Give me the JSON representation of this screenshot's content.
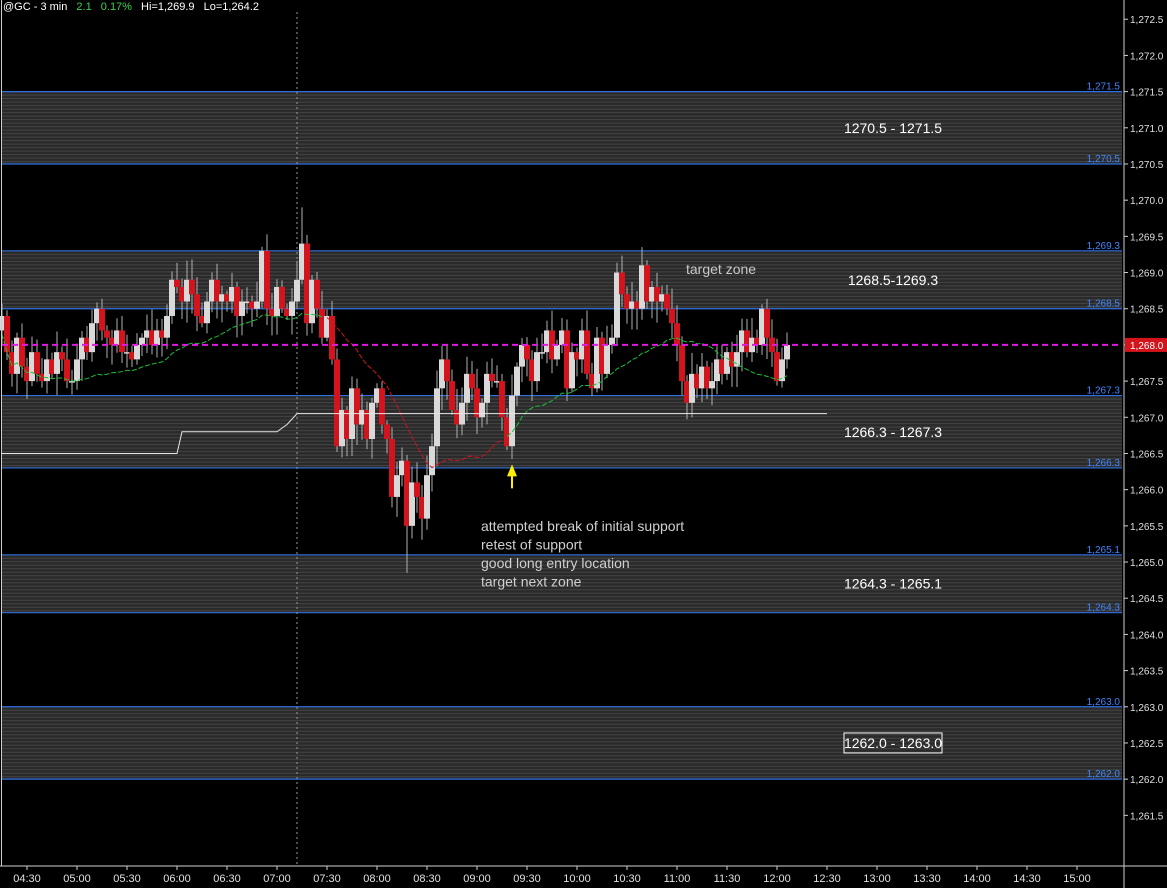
{
  "header": {
    "symbol": "@GC - 3 min",
    "change": "2.1",
    "change_pct": "0.17%",
    "high": "Hi=1,269.9",
    "low": "Lo=1,264.2"
  },
  "colors": {
    "background": "#000000",
    "zone_fill": "#2a2a2a",
    "zone_line": "#2f6fe0",
    "zone_label": "#3f86ff",
    "up_candle": "#d9d9d9",
    "down_candle": "#d3141c",
    "ma_green": "#19c23a",
    "ma_red": "#d3141c",
    "vwap_magenta": "#e01ae0",
    "white_line": "#e6e6e6",
    "arrow": "#ffee00"
  },
  "chart_data": {
    "type": "candlestick",
    "ylim": [
      1260.8,
      1272.6
    ],
    "y_ticks": [
      "1,272.5",
      "1,272.0",
      "1,271.5",
      "1,271.0",
      "1,270.5",
      "1,270.0",
      "1,269.5",
      "1,269.0",
      "1,268.5",
      "1,268.0",
      "1,267.5",
      "1,267.0",
      "1,266.5",
      "1,266.0",
      "1,265.5",
      "1,265.0",
      "1,264.5",
      "1,264.0",
      "1,263.5",
      "1,263.0",
      "1,262.5",
      "1,262.0",
      "1,261.5"
    ],
    "y_tick_values": [
      1272.5,
      1272.0,
      1271.5,
      1271.0,
      1270.5,
      1270.0,
      1269.5,
      1269.0,
      1268.5,
      1268.0,
      1267.5,
      1267.0,
      1266.5,
      1266.0,
      1265.5,
      1265.0,
      1264.5,
      1264.0,
      1263.5,
      1263.0,
      1262.5,
      1262.0,
      1261.5
    ],
    "x_ticks": [
      "04:30",
      "05:00",
      "05:30",
      "06:00",
      "06:30",
      "07:00",
      "07:30",
      "08:00",
      "08:30",
      "09:00",
      "09:30",
      "10:00",
      "10:30",
      "11:00",
      "11:30",
      "12:00",
      "12:30",
      "13:00",
      "13:30",
      "14:00",
      "14:30",
      "15:00"
    ],
    "x_start": "04:15",
    "x_end": "15:27",
    "bar_minutes": 3,
    "session_divider": "07:12",
    "current_price": "1,268.0",
    "current_price_value": 1268.0,
    "zones": [
      {
        "low": 1270.5,
        "high": 1271.5,
        "low_label": "1,270.5",
        "high_label": "1,271.5",
        "label": "1270.5 - 1271.5",
        "boxed": false
      },
      {
        "low": 1268.5,
        "high": 1269.3,
        "low_label": "1,268.5",
        "high_label": "1,269.3",
        "label": "1268.5-1269.3",
        "boxed": false
      },
      {
        "low": 1266.3,
        "high": 1267.3,
        "low_label": "1,266.3",
        "high_label": "1,267.3",
        "label": "1266.3 - 1267.3",
        "boxed": false
      },
      {
        "low": 1264.3,
        "high": 1265.1,
        "low_label": "1,264.3",
        "high_label": "1,265.1",
        "label": "1264.3 - 1265.1",
        "boxed": false
      },
      {
        "low": 1262.0,
        "high": 1263.0,
        "low_label": "1,262.0",
        "high_label": "1,263.0",
        "label": "1262.0 - 1263.0",
        "boxed": true
      }
    ],
    "annotations": {
      "target_zone": "target zone",
      "notes": [
        "attempted break of initial support",
        "retest of support",
        "good long entry location",
        "target next zone"
      ],
      "arrow_time": "09:21",
      "arrow_price": 1266.35
    },
    "closes": [
      1268.4,
      1267.9,
      1267.6,
      1268.1,
      1267.7,
      1267.5,
      1267.9,
      1267.6,
      1267.5,
      1267.8,
      1267.6,
      1267.9,
      1267.8,
      1267.5,
      1267.5,
      1267.8,
      1268.1,
      1267.9,
      1268.3,
      1268.5,
      1268.2,
      1268.1,
      1268.0,
      1268.2,
      1267.9,
      1267.9,
      1267.8,
      1268.0,
      1268.1,
      1268.2,
      1268.0,
      1268.2,
      1268.1,
      1268.4,
      1268.9,
      1268.8,
      1268.6,
      1268.9,
      1268.7,
      1268.4,
      1268.3,
      1268.6,
      1268.9,
      1268.6,
      1268.7,
      1268.6,
      1268.8,
      1268.4,
      1268.6,
      1268.6,
      1268.5,
      1268.6,
      1269.3,
      1268.5,
      1268.4,
      1268.8,
      1268.5,
      1268.4,
      1268.6,
      1268.9,
      1269.4,
      1268.3,
      1268.9,
      1268.5,
      1268.1,
      1268.4,
      1267.8,
      1266.6,
      1267.1,
      1266.7,
      1267.4,
      1266.9,
      1267.1,
      1266.7,
      1267.2,
      1267.4,
      1266.9,
      1266.7,
      1265.9,
      1266.2,
      1266.4,
      1265.5,
      1266.1,
      1265.9,
      1265.6,
      1266.2,
      1266.6,
      1267.4,
      1267.8,
      1267.5,
      1267.1,
      1266.9,
      1267.2,
      1267.6,
      1267.4,
      1267.0,
      1267.2,
      1267.6,
      1267.5,
      1267.5,
      1267.0,
      1266.6,
      1267.3,
      1267.7,
      1268.0,
      1267.8,
      1267.5,
      1267.9,
      1267.9,
      1268.2,
      1267.8,
      1268.0,
      1268.2,
      1267.4,
      1267.9,
      1267.8,
      1268.2,
      1267.6,
      1267.4,
      1268.1,
      1267.6,
      1268.0,
      1268.1,
      1269.0,
      1268.7,
      1268.5,
      1268.6,
      1268.5,
      1269.1,
      1268.6,
      1268.8,
      1268.6,
      1268.7,
      1268.5,
      1268.3,
      1268.0,
      1267.5,
      1267.2,
      1267.6,
      1267.4,
      1267.7,
      1267.4,
      1267.5,
      1267.8,
      1267.6,
      1267.9,
      1267.7,
      1267.9,
      1268.2,
      1267.9,
      1268.1,
      1268.0,
      1268.5,
      1268.1,
      1267.9,
      1267.5,
      1267.8,
      1268.0
    ]
  }
}
